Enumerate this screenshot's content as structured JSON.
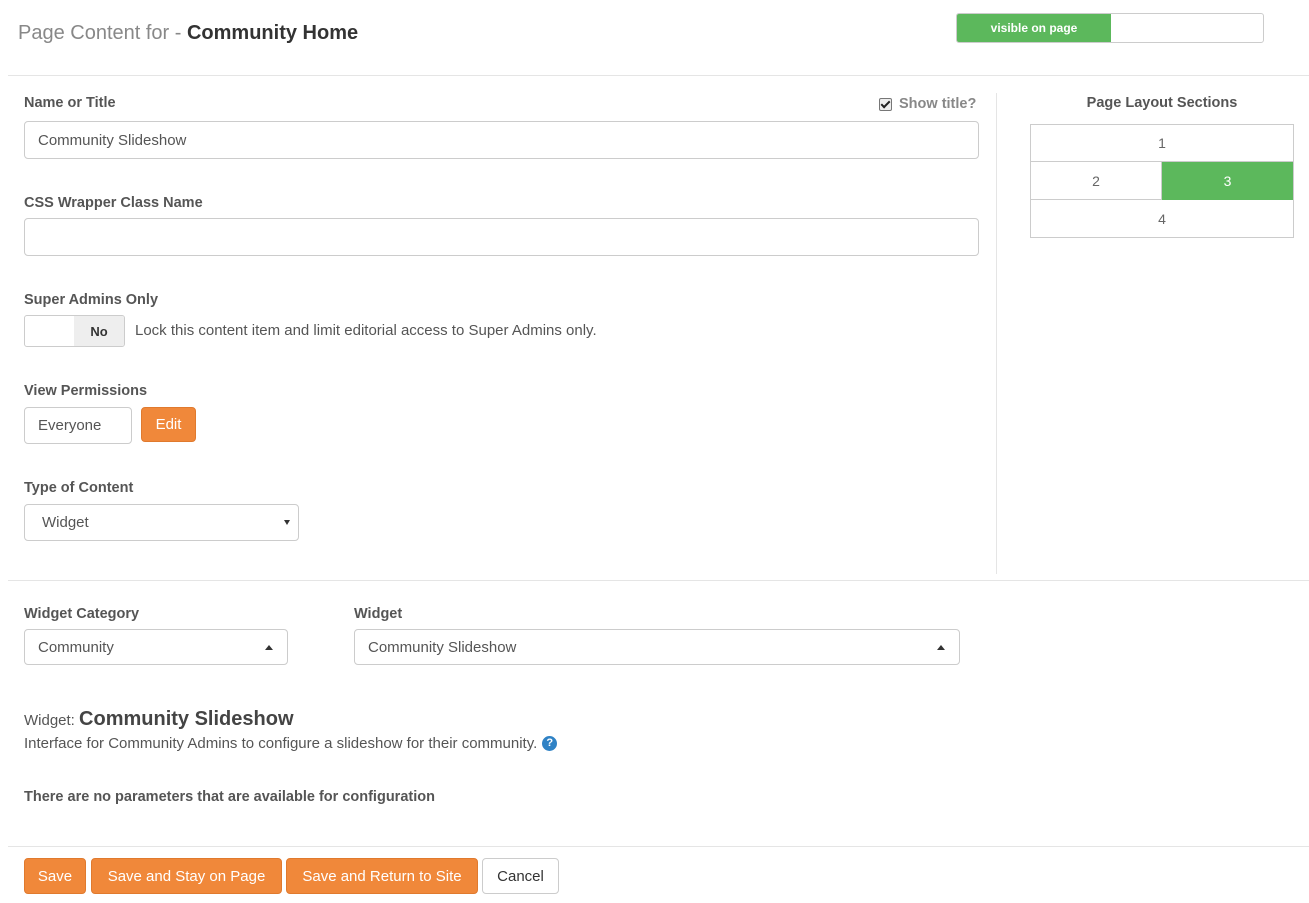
{
  "header": {
    "title_prefix": "Page Content for - ",
    "page_name": "Community Home",
    "visibility_label": "visible on page"
  },
  "form": {
    "name_label": "Name or Title",
    "show_title_label": "Show title?",
    "show_title_checked": true,
    "name_value": "Community Slideshow",
    "css_label": "CSS Wrapper Class Name",
    "css_value": "",
    "super_admins_label": "Super Admins Only",
    "super_admins_state": "No",
    "super_admins_desc": "Lock this content item and limit editorial access to Super Admins only.",
    "view_permissions_label": "View Permissions",
    "view_permissions_value": "Everyone",
    "edit_button": "Edit",
    "type_label": "Type of Content",
    "type_value": "Widget"
  },
  "layout": {
    "title": "Page Layout Sections",
    "sections": [
      "1",
      "2",
      "3",
      "4"
    ],
    "active_section": "3"
  },
  "widget": {
    "category_label": "Widget Category",
    "category_value": "Community",
    "widget_label": "Widget",
    "widget_value": "Community Slideshow",
    "heading_prefix": "Widget: ",
    "heading_name": "Community Slideshow",
    "description": "Interface for Community Admins to configure a slideshow for their community.",
    "help_icon": "?",
    "no_params": "There are no parameters that are available for configuration"
  },
  "footer": {
    "save": "Save",
    "save_stay": "Save and Stay on Page",
    "save_return": "Save and Return to Site",
    "cancel": "Cancel"
  },
  "colors": {
    "accent_orange": "#f0883a",
    "success_green": "#5cb85c",
    "help_blue": "#2f82c5"
  }
}
